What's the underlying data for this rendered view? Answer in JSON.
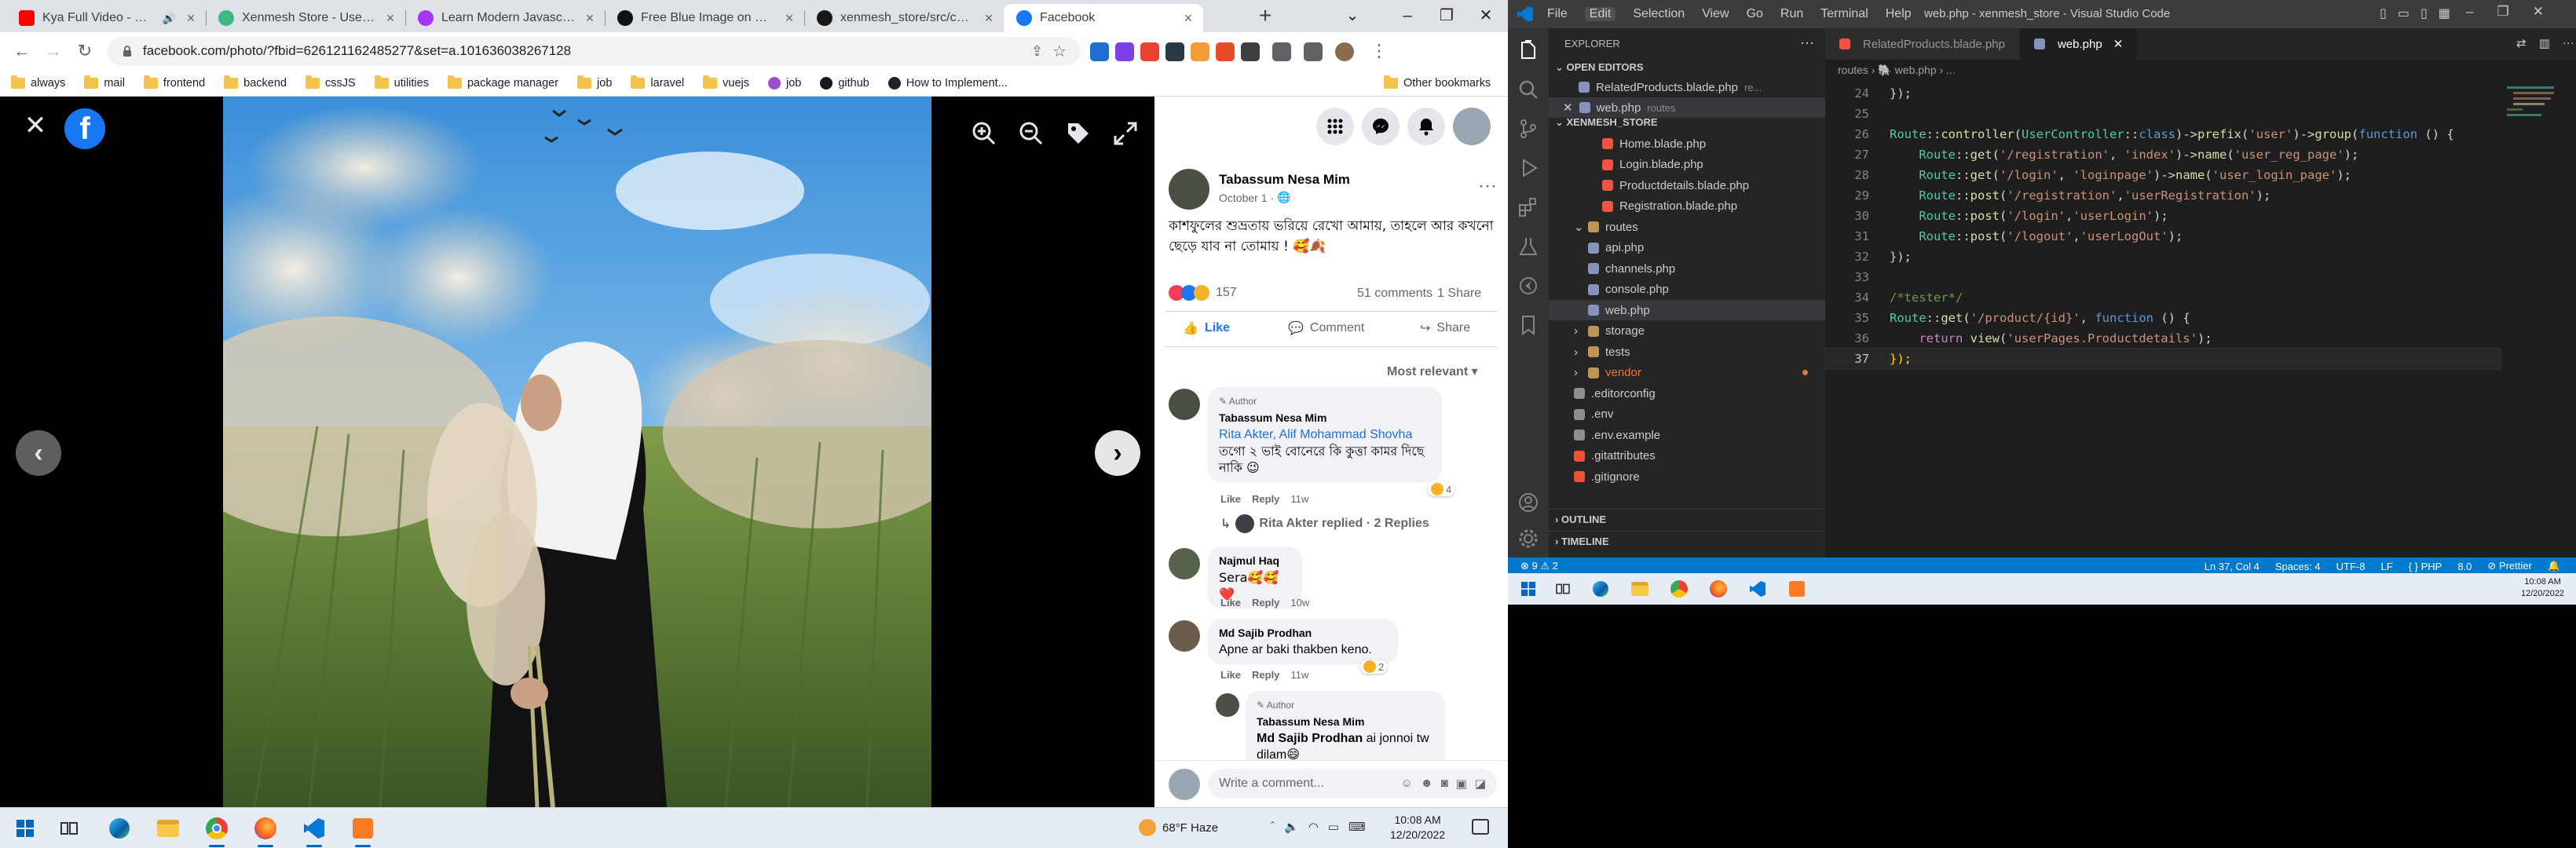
{
  "browser": {
    "tabs": [
      {
        "title": "Kya Full Video - Crooked",
        "icon": "youtube-icon",
        "color": "#ff0000",
        "audio": true
      },
      {
        "title": "Xenmesh Store - User Registration",
        "icon": "vue-icon",
        "color": "#41b883"
      },
      {
        "title": "Learn Modern Javascript (Build...",
        "icon": "udemy-icon",
        "color": "#a435f0"
      },
      {
        "title": "Free Blue Image on Unsplash",
        "icon": "unsplash-icon",
        "color": "#111111"
      },
      {
        "title": "xenmesh_store/src/components",
        "icon": "github-icon",
        "color": "#181717"
      },
      {
        "title": "Facebook",
        "icon": "facebook-icon",
        "color": "#1877f2",
        "active": true
      }
    ],
    "url": "facebook.com/photo/?fbid=626121162485277&set=a.101636038267128",
    "bookmarks": [
      {
        "label": "always",
        "type": "folder"
      },
      {
        "label": "mail",
        "type": "folder"
      },
      {
        "label": "frontend",
        "type": "folder"
      },
      {
        "label": "backend",
        "type": "folder"
      },
      {
        "label": "cssJS",
        "type": "folder"
      },
      {
        "label": "utilities",
        "type": "folder"
      },
      {
        "label": "package manager",
        "type": "folder"
      },
      {
        "label": "job",
        "type": "folder"
      },
      {
        "label": "laravel",
        "type": "folder"
      },
      {
        "label": "vuejs",
        "type": "folder"
      },
      {
        "label": "job",
        "type": "site",
        "color": "#9c4dcc"
      },
      {
        "label": "github",
        "type": "site",
        "color": "#181717"
      },
      {
        "label": "How to Implement...",
        "type": "site",
        "color": "#222222"
      }
    ],
    "other_bookmarks": "Other bookmarks"
  },
  "post": {
    "author": "Tabassum Nesa Mim",
    "date": "October 1",
    "text": "কাশফুলের শুভ্রতায় ভরিয়ে রেখো আমায়, তাহলে আর কখনো ছেড়ে যাব না তোমায় ! 🥰🍂",
    "reaction_count": "157",
    "comments_count": "51 comments",
    "shares_count": "1 Share",
    "like_label": "Like",
    "comment_label": "Comment",
    "share_label": "Share",
    "sort_label": "Most relevant"
  },
  "comments": [
    {
      "author_badge": "Author",
      "name": "Tabassum Nesa Mim",
      "mention": "Rita Akter, Alif Mohammad Shovha",
      "text": "তগো ২ ভাই বোনেরে কি কুত্তা কামর দিছে নাকি 😉",
      "like": "Like",
      "reply": "Reply",
      "time": "11w",
      "reactions": "4"
    },
    {
      "name": "Najmul Haq",
      "text": "Sera🥰🥰 ❤️",
      "like": "Like",
      "reply": "Reply",
      "time": "10w"
    },
    {
      "name": "Md Sajib Prodhan",
      "text": "Apne ar baki thakben keno.",
      "like": "Like",
      "reply": "Reply",
      "time": "11w",
      "reactions": "2"
    },
    {
      "author_badge": "Author",
      "name": "Tabassum Nesa Mim",
      "mention": "Md Sajib Prodhan",
      "text": "ai jonnoi tw dilam😄"
    }
  ],
  "replied_line": "Rita Akter replied · 2 Replies",
  "comment_placeholder": "Write a comment...",
  "taskbar": {
    "weather": "68°F  Haze",
    "time": "10:08 AM",
    "date": "12/20/2022"
  },
  "vscode": {
    "title": "web.php - xenmesh_store - Visual Studio Code",
    "menu": [
      "File",
      "Edit",
      "Selection",
      "View",
      "Go",
      "Run",
      "Terminal",
      "Help"
    ],
    "explorer_label": "EXPLORER",
    "open_editors_label": "OPEN EDITORS",
    "open_editors": [
      {
        "name": "RelatedProducts.blade.php",
        "path": "re..."
      },
      {
        "name": "web.php",
        "path": "routes"
      }
    ],
    "project_label": "XENMESH_STORE",
    "tree": [
      {
        "name": "Home.blade.php",
        "indent": 3,
        "kind": "blade"
      },
      {
        "name": "Login.blade.php",
        "indent": 3,
        "kind": "blade"
      },
      {
        "name": "Productdetails.blade.php",
        "indent": 3,
        "kind": "blade"
      },
      {
        "name": "Registration.blade.php",
        "indent": 3,
        "kind": "blade"
      },
      {
        "name": "routes",
        "indent": 1,
        "kind": "folder-open"
      },
      {
        "name": "api.php",
        "indent": 2,
        "kind": "php"
      },
      {
        "name": "channels.php",
        "indent": 2,
        "kind": "php"
      },
      {
        "name": "console.php",
        "indent": 2,
        "kind": "php"
      },
      {
        "name": "web.php",
        "indent": 2,
        "kind": "php",
        "selected": true
      },
      {
        "name": "storage",
        "indent": 1,
        "kind": "folder"
      },
      {
        "name": "tests",
        "indent": 1,
        "kind": "folder"
      },
      {
        "name": "vendor",
        "indent": 1,
        "kind": "folder",
        "color": "#e37933"
      },
      {
        "name": ".editorconfig",
        "indent": 1,
        "kind": "config"
      },
      {
        "name": ".env",
        "indent": 1,
        "kind": "config"
      },
      {
        "name": ".env.example",
        "indent": 1,
        "kind": "config"
      },
      {
        "name": ".gitattributes",
        "indent": 1,
        "kind": "git"
      },
      {
        "name": ".gitignore",
        "indent": 1,
        "kind": "git"
      }
    ],
    "outline_label": "OUTLINE",
    "timeline_label": "TIMELINE",
    "editor_tabs": [
      {
        "name": "RelatedProducts.blade.php"
      },
      {
        "name": "web.php",
        "active": true
      }
    ],
    "breadcrumb": "routes › 🐘 web.php › ...",
    "code_lines": [
      {
        "n": "24",
        "segs": [
          [
            "});",
            "#d4d4d4"
          ]
        ]
      },
      {
        "n": "25",
        "segs": []
      },
      {
        "n": "26",
        "segs": [
          [
            "Route",
            "#4ec9b0"
          ],
          [
            "::",
            "#d4d4d4"
          ],
          [
            "controller",
            "#dcdcaa"
          ],
          [
            "(",
            "#d4d4d4"
          ],
          [
            "UserController",
            "#4ec9b0"
          ],
          [
            "::",
            "#d4d4d4"
          ],
          [
            "class",
            "#569cd6"
          ],
          [
            ")->",
            "#d4d4d4"
          ],
          [
            "prefix",
            "#dcdcaa"
          ],
          [
            "(",
            "#d4d4d4"
          ],
          [
            "'user'",
            "#ce9178"
          ],
          [
            ")->",
            "#d4d4d4"
          ],
          [
            "group",
            "#dcdcaa"
          ],
          [
            "(",
            "#d4d4d4"
          ],
          [
            "function",
            "#569cd6"
          ],
          [
            " () {",
            "#d4d4d4"
          ]
        ]
      },
      {
        "n": "27",
        "segs": [
          [
            "    Route",
            "#4ec9b0"
          ],
          [
            "::",
            "#d4d4d4"
          ],
          [
            "get",
            "#dcdcaa"
          ],
          [
            "(",
            "#d4d4d4"
          ],
          [
            "'/registration'",
            "#ce9178"
          ],
          [
            ", ",
            "#d4d4d4"
          ],
          [
            "'index'",
            "#ce9178"
          ],
          [
            ")->",
            "#d4d4d4"
          ],
          [
            "name",
            "#dcdcaa"
          ],
          [
            "(",
            "#d4d4d4"
          ],
          [
            "'user_reg_page'",
            "#ce9178"
          ],
          [
            ");",
            "#d4d4d4"
          ]
        ]
      },
      {
        "n": "28",
        "segs": [
          [
            "    Route",
            "#4ec9b0"
          ],
          [
            "::",
            "#d4d4d4"
          ],
          [
            "get",
            "#dcdcaa"
          ],
          [
            "(",
            "#d4d4d4"
          ],
          [
            "'/login'",
            "#ce9178"
          ],
          [
            ", ",
            "#d4d4d4"
          ],
          [
            "'loginpage'",
            "#ce9178"
          ],
          [
            ")->",
            "#d4d4d4"
          ],
          [
            "name",
            "#dcdcaa"
          ],
          [
            "(",
            "#d4d4d4"
          ],
          [
            "'user_login_page'",
            "#ce9178"
          ],
          [
            ");",
            "#d4d4d4"
          ]
        ]
      },
      {
        "n": "29",
        "segs": [
          [
            "    Route",
            "#4ec9b0"
          ],
          [
            "::",
            "#d4d4d4"
          ],
          [
            "post",
            "#dcdcaa"
          ],
          [
            "(",
            "#d4d4d4"
          ],
          [
            "'/registration'",
            "#ce9178"
          ],
          [
            ",",
            "#d4d4d4"
          ],
          [
            "'userRegistration'",
            "#ce9178"
          ],
          [
            ");",
            "#d4d4d4"
          ]
        ]
      },
      {
        "n": "30",
        "segs": [
          [
            "    Route",
            "#4ec9b0"
          ],
          [
            "::",
            "#d4d4d4"
          ],
          [
            "post",
            "#dcdcaa"
          ],
          [
            "(",
            "#d4d4d4"
          ],
          [
            "'/login'",
            "#ce9178"
          ],
          [
            ",",
            "#d4d4d4"
          ],
          [
            "'userLogin'",
            "#ce9178"
          ],
          [
            ");",
            "#d4d4d4"
          ]
        ]
      },
      {
        "n": "31",
        "segs": [
          [
            "    Route",
            "#4ec9b0"
          ],
          [
            "::",
            "#d4d4d4"
          ],
          [
            "post",
            "#dcdcaa"
          ],
          [
            "(",
            "#d4d4d4"
          ],
          [
            "'/logout'",
            "#ce9178"
          ],
          [
            ",",
            "#d4d4d4"
          ],
          [
            "'userLogOut'",
            "#ce9178"
          ],
          [
            ");",
            "#d4d4d4"
          ]
        ]
      },
      {
        "n": "32",
        "segs": [
          [
            "});",
            "#d4d4d4"
          ]
        ]
      },
      {
        "n": "33",
        "segs": []
      },
      {
        "n": "34",
        "segs": [
          [
            "/*tester*/",
            "#6a9955"
          ]
        ]
      },
      {
        "n": "35",
        "segs": [
          [
            "Route",
            "#4ec9b0"
          ],
          [
            "::",
            "#d4d4d4"
          ],
          [
            "get",
            "#dcdcaa"
          ],
          [
            "(",
            "#d4d4d4"
          ],
          [
            "'/product/{id}'",
            "#ce9178"
          ],
          [
            ", ",
            "#d4d4d4"
          ],
          [
            "function",
            "#569cd6"
          ],
          [
            " () {",
            "#d4d4d4"
          ]
        ]
      },
      {
        "n": "36",
        "segs": [
          [
            "    ",
            "#d4d4d4"
          ],
          [
            "return",
            "#c586c0"
          ],
          [
            " ",
            "#d4d4d4"
          ],
          [
            "view",
            "#dcdcaa"
          ],
          [
            "(",
            "#d4d4d4"
          ],
          [
            "'userPages.Productdetails'",
            "#ce9178"
          ],
          [
            ");",
            "#d4d4d4"
          ]
        ]
      },
      {
        "n": "37",
        "segs": [
          [
            "});",
            "#ffd700"
          ]
        ],
        "current": true
      }
    ],
    "status": {
      "problems": "⊗ 9 ⚠ 2",
      "position": "Ln 37, Col 4",
      "spaces": "Spaces: 4",
      "encoding": "UTF-8",
      "eol": "LF",
      "language": "PHP",
      "version": "8.0",
      "prettier": "⊘ Prettier"
    },
    "taskbar_time": "10:08 AM",
    "taskbar_date": "12/20/2022"
  }
}
